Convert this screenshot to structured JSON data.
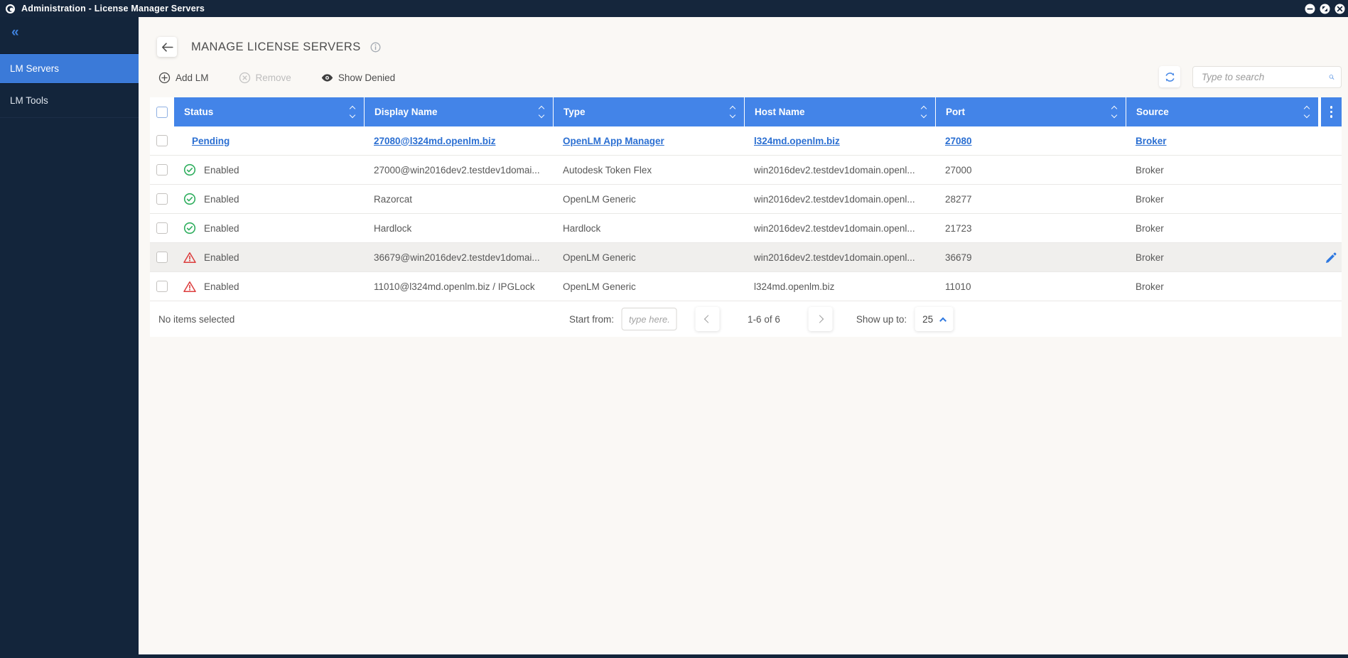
{
  "titlebar": {
    "title": "Administration - License Manager Servers"
  },
  "sidebar": {
    "collapse_glyph": "«",
    "items": [
      {
        "label": "LM Servers",
        "active": true
      },
      {
        "label": "LM Tools",
        "active": false
      }
    ]
  },
  "header": {
    "title": "MANAGE LICENSE SERVERS"
  },
  "toolbar": {
    "add_label": "Add LM",
    "remove_label": "Remove",
    "show_denied_label": "Show Denied",
    "search_placeholder": "Type to search"
  },
  "table": {
    "columns": [
      "Status",
      "Display Name",
      "Type",
      "Host Name",
      "Port",
      "Source"
    ],
    "rows": [
      {
        "status": "Pending",
        "display": "27080@l324md.openlm.biz",
        "type": "OpenLM App Manager",
        "host": "l324md.openlm.biz",
        "port": "27080",
        "source": "Broker",
        "icon": "none",
        "link": true,
        "highlight": false,
        "editable": false
      },
      {
        "status": "Enabled",
        "display": "27000@win2016dev2.testdev1domai...",
        "type": "Autodesk Token Flex",
        "host": "win2016dev2.testdev1domain.openl...",
        "port": "27000",
        "source": "Broker",
        "icon": "ok",
        "link": false,
        "highlight": false,
        "editable": false
      },
      {
        "status": "Enabled",
        "display": "Razorcat",
        "type": "OpenLM Generic",
        "host": "win2016dev2.testdev1domain.openl...",
        "port": "28277",
        "source": "Broker",
        "icon": "ok",
        "link": false,
        "highlight": false,
        "editable": false
      },
      {
        "status": "Enabled",
        "display": "Hardlock",
        "type": "Hardlock",
        "host": "win2016dev2.testdev1domain.openl...",
        "port": "21723",
        "source": "Broker",
        "icon": "ok",
        "link": false,
        "highlight": false,
        "editable": false
      },
      {
        "status": "Enabled",
        "display": "36679@win2016dev2.testdev1domai...",
        "type": "OpenLM Generic",
        "host": "win2016dev2.testdev1domain.openl...",
        "port": "36679",
        "source": "Broker",
        "icon": "warn",
        "link": false,
        "highlight": true,
        "editable": true
      },
      {
        "status": "Enabled",
        "display": "11010@l324md.openlm.biz / IPGLock",
        "type": "OpenLM Generic",
        "host": "l324md.openlm.biz",
        "port": "11010",
        "source": "Broker",
        "icon": "warn",
        "link": false,
        "highlight": false,
        "editable": false
      }
    ]
  },
  "footer": {
    "selection_text": "No items selected",
    "start_from_label": "Start from:",
    "start_from_placeholder": "type here..",
    "range_text": "1-6 of 6",
    "show_up_to_label": "Show up to:",
    "page_size": "25"
  },
  "colors": {
    "titlebar_bg": "#15263c",
    "sidebar_bg": "#13253b",
    "active_nav_bg": "#3b7ad8",
    "table_header_bg": "#4384e8",
    "link_blue": "#2b6fd2",
    "status_ok_green": "#2fae5e",
    "status_warn_red": "#dc3c3c",
    "page_bg": "#faf8f5"
  }
}
